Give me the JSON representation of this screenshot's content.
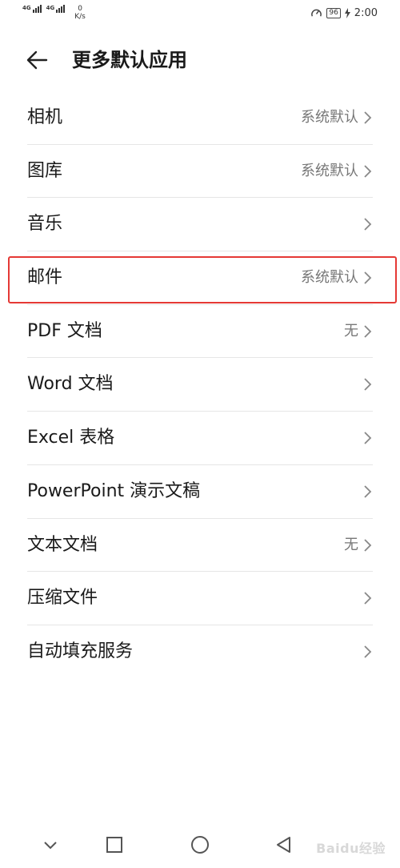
{
  "status_bar": {
    "network1": "4G",
    "network2": "4G",
    "speed_value": "0",
    "speed_unit": "K/s",
    "battery": "96",
    "time": "2:00"
  },
  "header": {
    "title": "更多默认应用"
  },
  "settings": [
    {
      "label": "相机",
      "value": "系统默认"
    },
    {
      "label": "图库",
      "value": "系统默认"
    },
    {
      "label": "音乐",
      "value": ""
    },
    {
      "label": "邮件",
      "value": "系统默认"
    },
    {
      "label": "PDF 文档",
      "value": "无"
    },
    {
      "label": "Word 文档",
      "value": ""
    },
    {
      "label": "Excel 表格",
      "value": ""
    },
    {
      "label": "PowerPoint 演示文稿",
      "value": ""
    },
    {
      "label": "文本文档",
      "value": "无"
    },
    {
      "label": "压缩文件",
      "value": ""
    },
    {
      "label": "自动填充服务",
      "value": ""
    }
  ],
  "watermark": "Baidu经验",
  "colors": {
    "highlight": "#e53935",
    "divider": "#e6e6e6",
    "secondary_text": "#777777"
  }
}
